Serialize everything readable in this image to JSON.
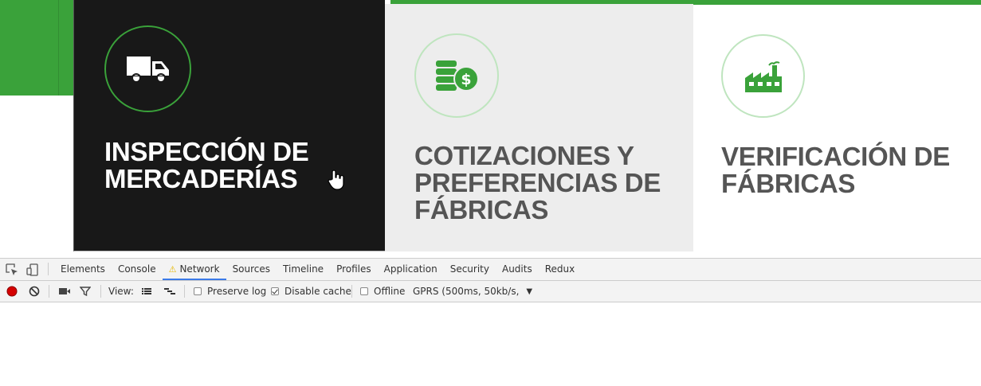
{
  "site": {
    "cards": [
      {
        "title": "INSPECCIÓN DE\nMERCADERÍAS",
        "icon": "truck-icon"
      },
      {
        "title": "COTIZACIONES Y\nPREFERENCIAS DE\nFÁBRICAS",
        "icon": "coins-dollar-icon"
      },
      {
        "title": "VERIFICACIÓN DE\nFÁBRICAS",
        "icon": "factory-icon"
      }
    ],
    "colors": {
      "accent": "#3aa23a",
      "dark_card": "#181818",
      "grey_card": "#ededed"
    }
  },
  "devtools": {
    "tabs": [
      "Elements",
      "Console",
      "Network",
      "Sources",
      "Timeline",
      "Profiles",
      "Application",
      "Security",
      "Audits",
      "Redux"
    ],
    "active_tab": "Network",
    "toolbar": {
      "view_label": "View:",
      "preserve_log": {
        "label": "Preserve log",
        "checked": false
      },
      "disable_cache": {
        "label": "Disable cache",
        "checked": true
      },
      "offline": {
        "label": "Offline",
        "checked": false
      },
      "throttle_value": "GPRS (500ms, 50kb/s,",
      "record_color": "#d50000"
    }
  }
}
